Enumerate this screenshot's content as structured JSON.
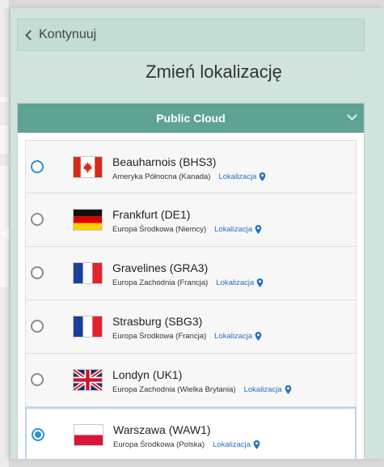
{
  "panel": {
    "back_label": "Kontynuuj",
    "title": "Zmień lokalizację"
  },
  "section": {
    "title": "Public Cloud"
  },
  "location_link_label": "Lokalizacja",
  "locations": [
    {
      "name": "Beauharnois (BHS3)",
      "region": "Ameryka Północna (Kanada)",
      "link": "Lokalizacja",
      "flag": "canada-flag",
      "state": "focused"
    },
    {
      "name": "Frankfurt (DE1)",
      "region": "Europa Środkowa (Niemcy)",
      "link": "Lokalizacja",
      "flag": "germany-flag",
      "state": "unchecked"
    },
    {
      "name": "Gravelines (GRA3)",
      "region": "Europa Zachodnia (Francja)",
      "link": "Lokalizacja",
      "flag": "france-flag",
      "state": "unchecked"
    },
    {
      "name": "Strasburg (SBG3)",
      "region": "Europa Środkowa (Francja)",
      "link": "Lokalizacja",
      "flag": "france-flag",
      "state": "unchecked"
    },
    {
      "name": "Londyn (UK1)",
      "region": "Europa Zachodnia (Wielka Brytania)",
      "link": "Lokalizacja",
      "flag": "uk-flag",
      "state": "unchecked"
    },
    {
      "name": "Warszawa (WAW1)",
      "region": "Europa Środkowa (Polska)",
      "link": "Lokalizacja",
      "flag": "poland-flag",
      "state": "checked"
    }
  ],
  "colors": {
    "panel_bg": "#d0e3dc",
    "header_bg": "#5fa395",
    "accent": "#2d8fd5",
    "link": "#2b6fbf"
  }
}
